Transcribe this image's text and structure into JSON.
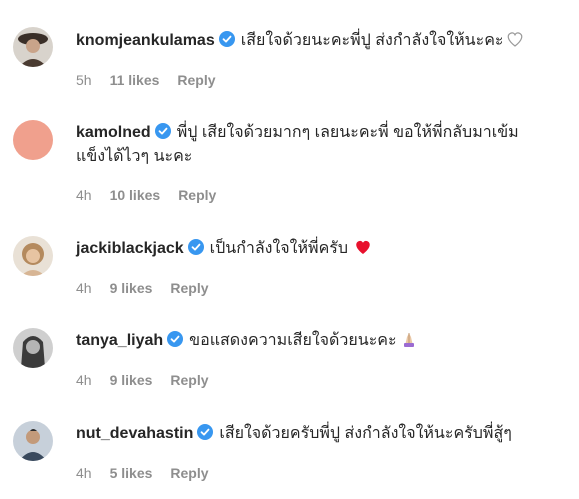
{
  "comments": [
    {
      "username": "knomjeankulamas",
      "text": "เสียใจด้วยนะคะพี่ปู ส่งกำลังใจให้นะคะ",
      "emoji": "heart-outline-icon",
      "time": "5h",
      "likes": "11 likes",
      "reply": "Reply",
      "avatar_color": "#7a6a5d"
    },
    {
      "username": "kamolned",
      "text": "พี่ปู เสียใจด้วยมากๆ เลยนะคะพี่ ขอให้พี่กลับมาเข้ม",
      "text_line2": "แข็งได้ไวๆ นะคะ",
      "time": "4h",
      "likes": "10 likes",
      "reply": "Reply",
      "avatar_color": "#f0a08d"
    },
    {
      "username": "jackiblackjack",
      "text": "เป็นกำลังใจให้พี่ครับ",
      "emoji": "red-heart-icon",
      "time": "4h",
      "likes": "9 likes",
      "reply": "Reply",
      "avatar_color": "#c9a98a"
    },
    {
      "username": "tanya_liyah",
      "text": "ขอแสดงความเสียใจด้วยนะคะ",
      "emoji": "praying-hands-icon",
      "time": "4h",
      "likes": "9 likes",
      "reply": "Reply",
      "avatar_color": "#8c8c8c"
    },
    {
      "username": "nut_devahastin",
      "text": "เสียใจด้วยครับพี่ปู ส่งกำลังใจให้นะครับพี่สู้ๆ",
      "time": "4h",
      "likes": "5 likes",
      "reply": "Reply",
      "avatar_color": "#6f7f92"
    }
  ],
  "colors": {
    "verified_blue": "#3897f0",
    "meta_gray": "#8e8e8e",
    "heart_red": "#ed4956"
  }
}
